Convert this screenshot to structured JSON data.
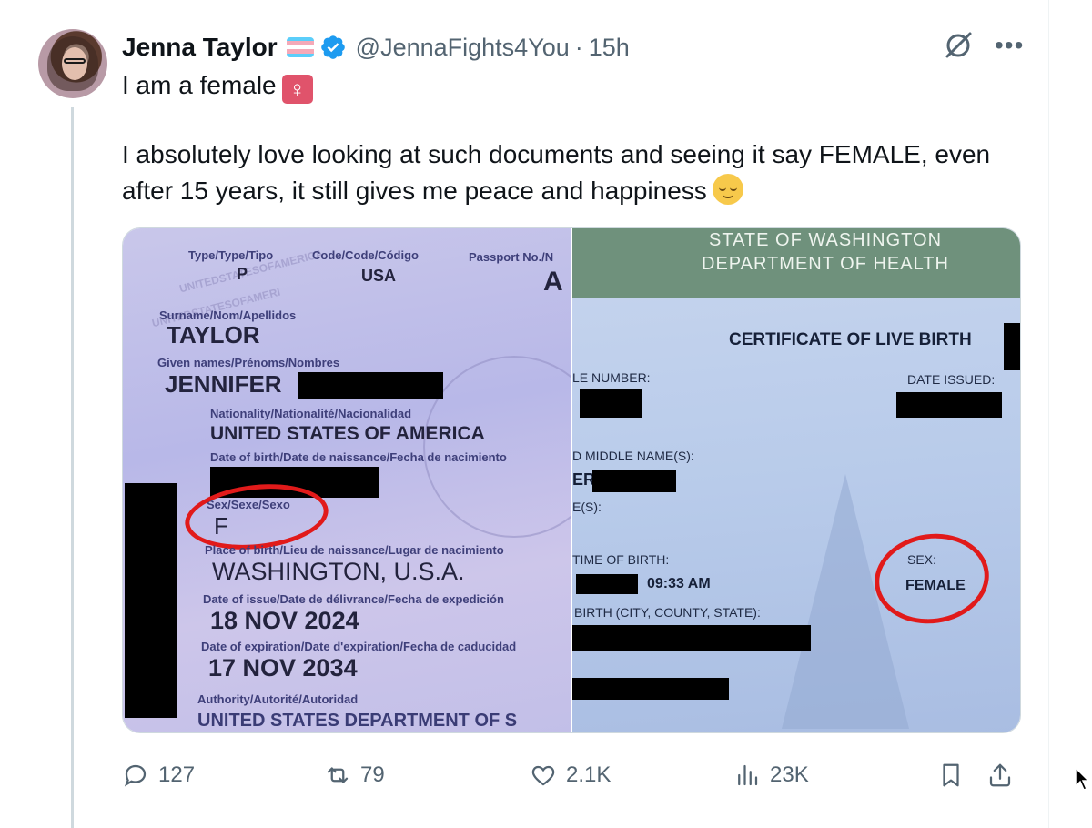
{
  "tweet": {
    "author_name": "Jenna Taylor",
    "handle": "@JennaFights4You",
    "separator": "·",
    "time": "15h",
    "line1": "I am a female",
    "line2": "I absolutely love looking at such documents and seeing it say FEMALE, even after 15 years, it still gives me peace and happiness",
    "emoji_female": "♀",
    "icons": {
      "verified": "verified-badge-icon",
      "flag": "trans-flag-icon",
      "grok": "grok-icon",
      "more": "more-options-icon"
    }
  },
  "passport": {
    "type_label": "Type/Type/Tipo",
    "type_value": "P",
    "code_label": "Code/Code/Código",
    "code_value": "USA",
    "passport_no_label": "Passport No./N",
    "passport_no_value": "A",
    "surname_label": "Surname/Nom/Apellidos",
    "surname_value": "TAYLOR",
    "given_label": "Given names/Prénoms/Nombres",
    "given_value": "JENNIFER",
    "nationality_label": "Nationality/Nationalité/Nacionalidad",
    "nationality_value": "UNITED STATES OF AMERICA",
    "dob_label": "Date of birth/Date de naissance/Fecha de nacimiento",
    "sex_label": "Sex/Sexe/Sexo",
    "sex_value": "F",
    "pob_label": "Place of birth/Lieu de naissance/Lugar de nacimiento",
    "pob_value": "WASHINGTON, U.S.A.",
    "issue_label": "Date of issue/Date de délivrance/Fecha de expedición",
    "issue_value": "18 NOV 2024",
    "expiry_label": "Date of expiration/Date d'expiration/Fecha de caducidad",
    "expiry_value": "17 NOV 2034",
    "authority_label": "Authority/Autorité/Autoridad",
    "authority_value": "UNITED STATES DEPARTMENT OF S"
  },
  "certificate": {
    "banner_line1": "STATE OF WASHINGTON",
    "banner_line2": "DEPARTMENT OF HEALTH",
    "title": "CERTIFICATE OF LIVE BIRTH",
    "file_number_label": "LE NUMBER:",
    "date_issued_label": "DATE ISSUED:",
    "middle_name_label": "D MIDDLE NAME(S):",
    "partial_name": "ER",
    "names_label": "E(S):",
    "time_label": "TIME OF BIRTH:",
    "time_value": "09:33 AM",
    "birthplace_label": "BIRTH (CITY, COUNTY, STATE):",
    "sex_label": "SEX:",
    "sex_value": "FEMALE"
  },
  "actions": {
    "replies": "127",
    "reposts": "79",
    "likes": "2.1K",
    "views": "23K"
  }
}
